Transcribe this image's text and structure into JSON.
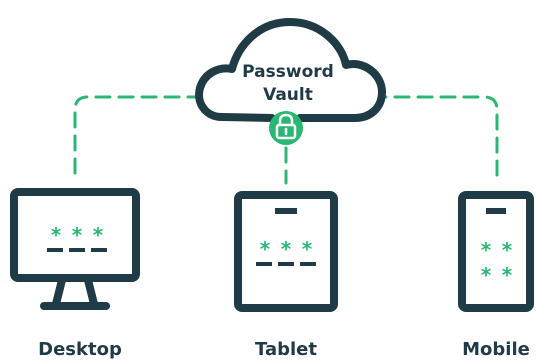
{
  "cloud": {
    "line1": "Password",
    "line2": "Vault",
    "icon": "padlock-icon"
  },
  "devices": {
    "desktop": {
      "label": "Desktop",
      "icon": "desktop-monitor-icon"
    },
    "tablet": {
      "label": "Tablet",
      "icon": "tablet-icon"
    },
    "mobile": {
      "label": "Mobile",
      "icon": "mobile-phone-icon"
    }
  },
  "colors": {
    "outline": "#1f3b46",
    "accent": "#2bb673",
    "background": "#ffffff"
  }
}
